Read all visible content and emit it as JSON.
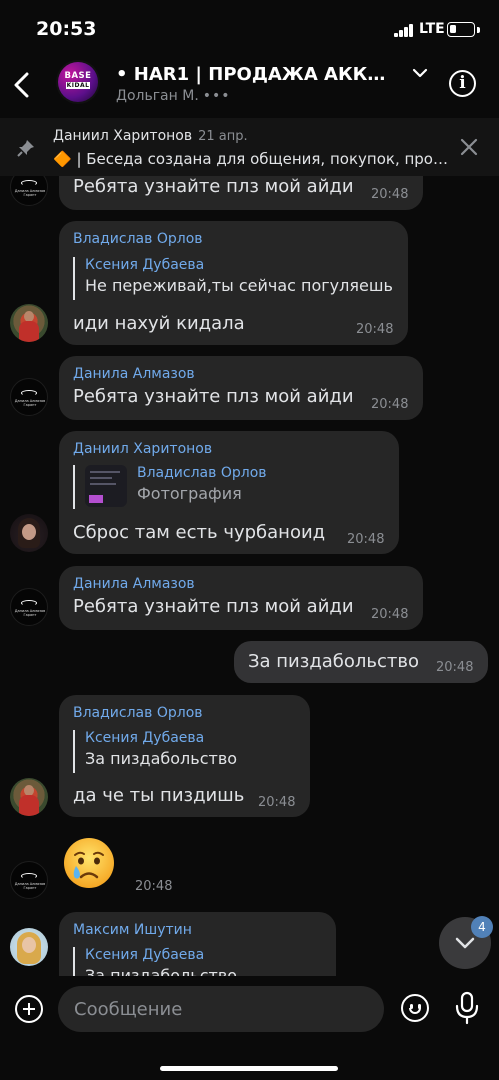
{
  "status_bar": {
    "time": "20:53",
    "network": "LTE",
    "battery_level": 0.3
  },
  "header": {
    "back_icon": "chevron-left-icon",
    "avatar_logo_top": "BASE",
    "avatar_logo_bottom": "KIDAL",
    "title": "• HAR1 | ПРОДАЖА АККАУН...",
    "subtitle": "Дольган М.",
    "typing_indicator": "•••",
    "info_icon": "info-icon"
  },
  "pinned": {
    "author": "Даниил Харитонов",
    "date": "21 апр.",
    "text": "🔶 | Беседа создана для общения, покупок, продажи"
  },
  "messages": [
    {
      "sender": "",
      "text": "Ребята узнайте плз мой айди",
      "time": "20:48",
      "avatar_caption": "Данила Алмазов Гарант"
    },
    {
      "sender": "Владислав Орлов",
      "reply_author": "Ксения Дубаева",
      "reply_text": "Не переживай,ты сейчас погуляешь",
      "text": "иди нахуй кидала",
      "time": "20:48"
    },
    {
      "sender": "Данила Алмазов",
      "text": "Ребята узнайте плз мой айди",
      "time": "20:48",
      "avatar_caption": "Данила Алмазов Гарант"
    },
    {
      "sender": "Даниил Харитонов",
      "reply_author": "Владислав Орлов",
      "reply_text": "Фотография",
      "text": "Сброс там есть чурбаноид",
      "time": "20:48"
    },
    {
      "sender": "Данила Алмазов",
      "text": "Ребята узнайте плз мой айди",
      "time": "20:48",
      "avatar_caption": "Данила Алмазов Гарант"
    },
    {
      "sender": "",
      "text": "За пиздабольство",
      "time": "20:48",
      "outgoing": true
    },
    {
      "sender": "Владислав Орлов",
      "reply_author": "Ксения Дубаева",
      "reply_text": "За пиздабольство",
      "text": "да че ты пиздишь",
      "time": "20:48"
    },
    {
      "sender": "",
      "emoji": "crying-face",
      "time": "20:48",
      "avatar_caption": "Данила Алмазов Гарант"
    },
    {
      "sender": "Максим Ишутин",
      "reply_author": "Ксения Дубаева",
      "reply_text": "За пиздабольство"
    }
  ],
  "unread_count": "4",
  "composer": {
    "placeholder": "Сообщение",
    "add_icon": "plus-icon",
    "sticker_icon": "smiley-icon",
    "mic_icon": "microphone-icon"
  }
}
